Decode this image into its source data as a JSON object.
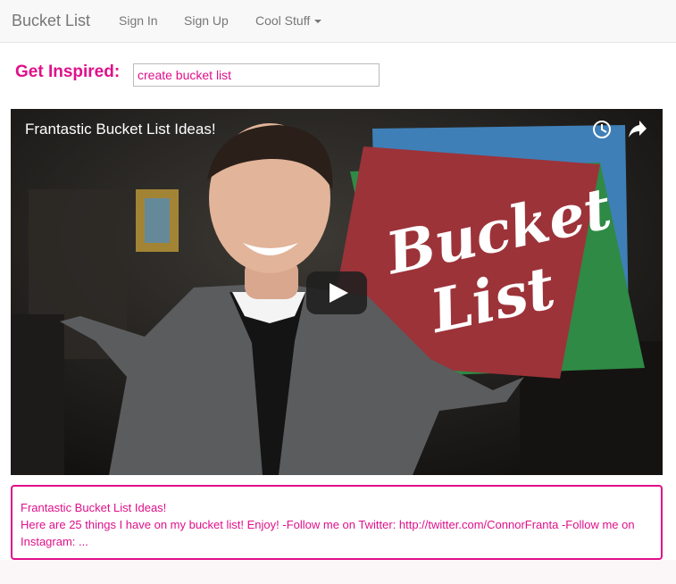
{
  "navbar": {
    "brand": "Bucket List",
    "links": [
      "Sign In",
      "Sign Up"
    ],
    "dropdown_label": "Cool Stuff"
  },
  "search": {
    "label": "Get Inspired:",
    "value": "create bucket list"
  },
  "video": {
    "title": "Frantastic Bucket List Ideas!",
    "thumbnail_text": [
      "Bucket",
      "List"
    ],
    "controls": [
      "clock-icon",
      "share-icon",
      "play-icon"
    ]
  },
  "info": {
    "title": "Frantastic Bucket List Ideas!",
    "description": "Here are 25 things I have on my bucket list! Enjoy! -Follow me on Twitter: http://twitter.com/ConnorFranta -Follow me on Instagram: ..."
  },
  "colors": {
    "accent": "#e0108a",
    "navbar_bg": "#f8f8f8",
    "nav_text": "#777777"
  }
}
